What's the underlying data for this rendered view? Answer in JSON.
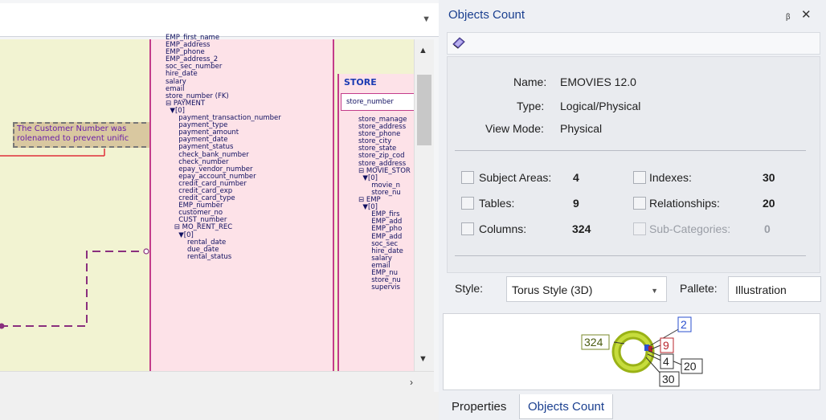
{
  "diagram": {
    "note_line1": "The Customer Number was",
    "note_line2": "rolenamed to prevent unific",
    "store_title": "STORE",
    "store_pk": "store_number",
    "emp_columns": "EMP_first_name\nEMP_address\nEMP_phone\nEMP_address_2\nsoc_sec_number\nhire_date\nsalary\nemail\nstore_number (FK)\n⊟ PAYMENT\n  ▼[0]\n      payment_transaction_number\n      payment_type\n      payment_amount\n      payment_date\n      payment_status\n      check_bank_number\n      check_number\n      epay_vendor_number\n      epay_account_number\n      credit_card_number\n      credit_card_exp\n      credit_card_type\n      EMP_number\n      customer_no\n      CUST_number\n    ⊟ MO_RENT_REC\n      ▼[0]\n          rental_date\n          due_date\n          rental_status",
    "store_columns": "store_manage\nstore_address\nstore_phone\nstore_city\nstore_state\nstore_zip_cod\nstore_address\n⊟ MOVIE_STOR\n  ▼[0]\n      movie_n\n      store_nu\n⊟ EMP\n  ▼[0]\n      EMP_firs\n      EMP_add\n      EMP_pho\n      EMP_add\n      soc_sec\n      hire_date\n      salary\n      email\n      EMP_nu\n      store_nu\n      supervis"
  },
  "panel": {
    "title": "Objects Count",
    "name_label": "Name:",
    "name_value": "EMOVIES 12.0",
    "type_label": "Type:",
    "type_value": "Logical/Physical",
    "view_label": "View Mode:",
    "view_value": "Physical",
    "counts": {
      "subject_areas_label": "Subject Areas:",
      "subject_areas_value": "4",
      "tables_label": "Tables:",
      "tables_value": "9",
      "columns_label": "Columns:",
      "columns_value": "324",
      "indexes_label": "Indexes:",
      "indexes_value": "30",
      "relationships_label": "Relationships:",
      "relationships_value": "20",
      "subcategories_label": "Sub-Categories:",
      "subcategories_value": "0"
    },
    "style_label": "Style:",
    "style_value": "Torus Style (3D)",
    "pallete_label": "Pallete:",
    "pallete_value": "Illustration",
    "chart_labels": {
      "columns": "324",
      "subject_areas": "2",
      "tables": "9",
      "four": "4",
      "relationships": "20",
      "indexes": "30"
    }
  },
  "tabs": {
    "properties": "Properties",
    "objects_count": "Objects Count"
  },
  "colors": {
    "accent": "#1a3f8f",
    "entity_border": "#c33c8a",
    "entity_fill": "#fde2e8",
    "torus": "#a8c21a"
  },
  "icons": [
    "chevron-down-icon",
    "scroll-up-icon",
    "scroll-down-icon",
    "scroll-right-icon",
    "pin-icon",
    "close-icon",
    "book-icon"
  ]
}
